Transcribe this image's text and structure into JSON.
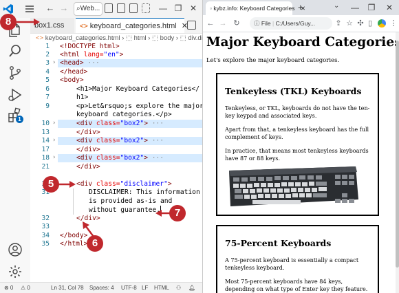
{
  "vscode": {
    "search_label": "Web...",
    "tabs": [
      {
        "label": "box1.css"
      },
      {
        "label": "keyboard_categories.html"
      }
    ],
    "breadcrumb": {
      "file": "keyboard_categories.html",
      "path1": "html",
      "path2": "body",
      "path3": "div.di"
    },
    "lines": [
      {
        "n": "1"
      },
      {
        "n": "2"
      },
      {
        "n": "3"
      },
      {
        "n": "4"
      },
      {
        "n": "5"
      },
      {
        "n": "6"
      },
      {
        "n": "7"
      },
      {
        "n": "8"
      },
      {
        "n": ""
      },
      {
        "n": "9"
      },
      {
        "n": ""
      },
      {
        "n": "10"
      },
      {
        "n": "13"
      },
      {
        "n": "14"
      },
      {
        "n": "17"
      },
      {
        "n": "18"
      },
      {
        "n": "21"
      },
      {
        "n": "22"
      },
      {
        "n": "30"
      },
      {
        "n": "31"
      },
      {
        "n": ""
      },
      {
        "n": ""
      },
      {
        "n": "32"
      },
      {
        "n": "33"
      },
      {
        "n": "34"
      },
      {
        "n": "35"
      }
    ],
    "code": {
      "doctype": "<!DOCTYPE html>",
      "html_open": "<html",
      "lang_attr": " lang=",
      "lang_val": "\"en\"",
      "gt": ">",
      "head_open": "<head>",
      "ellipsis": " ···",
      "head_close": "</head>",
      "body_open": "<body>",
      "h1_line1": "<h1>Major Keyboard Categories</",
      "h1_line2": "h1>",
      "p_line1": "<p>Let&rsquo;s explore the major",
      "p_line2": "keyboard categories.</p>",
      "div_open": "<div",
      "class_attr": " class=",
      "box2_val": "\"box2\"",
      "div_close": "</div>",
      "disclaimer_val": "\"disclaimer\"",
      "disc_line1": "DISCLAIMER: This information",
      "disc_line2": "is provided as-is and",
      "disc_line3": "without guarantee.",
      "body_close": "</body>",
      "html_close": "</html>"
    },
    "status": {
      "errors": "⊗ 0",
      "warnings": "⚠ 0",
      "position": "Ln 31, Col 78",
      "spaces": "Spaces: 4",
      "encoding": "UTF-8",
      "eol": "LF",
      "language": "HTML"
    },
    "extensions_badge": "1",
    "accent": "#0066b8"
  },
  "chrome": {
    "tab_title": "kybz.info: Keyboard Categories",
    "new_tab": "+",
    "omnibox_prefix": "File",
    "omnibox_url": "C:/Users/Guy...",
    "page": {
      "title": "Major Keyboard Categories",
      "intro": "Let's explore the major keyboard categories.",
      "box1": {
        "heading": "Tenkeyless (TKL) Keyboards",
        "p1": "Tenkeyless, or TKL, keyboards do not have the ten-key keypad and associated keys.",
        "p2": "Apart from that, a tenkeyless keyboard has the full complement of keys.",
        "p3": "In practice, that means most tenkeyless keyboards have 87 or 88 keys."
      },
      "box2": {
        "heading": "75-Percent Keyboards",
        "p1": "A 75-percent keyboard is essentially a compact tenkeyless keyboard.",
        "p2": "Most 75-percent keyboards have 84 keys, depending on what type of Enter key they feature."
      }
    }
  },
  "callouts": {
    "c5": "5",
    "c6": "6",
    "c7": "7",
    "c8": "8"
  },
  "colors": {
    "callout": "#c0282d",
    "line_highlight": "#d6ebff"
  }
}
